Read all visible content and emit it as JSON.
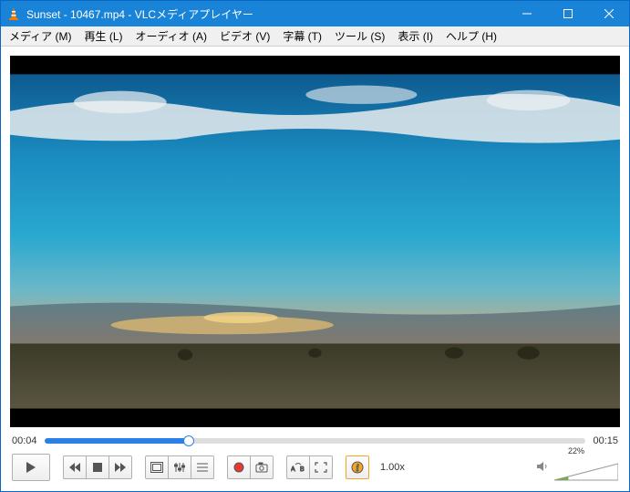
{
  "titlebar": {
    "title": "Sunset - 10467.mp4 - VLCメディアプレイヤー"
  },
  "menu": {
    "media": "メディア (M)",
    "playback": "再生 (L)",
    "audio": "オーディオ (A)",
    "video": "ビデオ (V)",
    "subtitle": "字幕 (T)",
    "tools": "ツール (S)",
    "view": "表示 (I)",
    "help": "ヘルプ (H)"
  },
  "playback": {
    "current_time": "00:04",
    "total_time": "00:15",
    "progress_percent": 26.7,
    "speed": "1.00x"
  },
  "volume": {
    "level_text": "22%",
    "level_percent": 22
  },
  "icons": {
    "play": "play",
    "prev": "prev",
    "stop": "stop",
    "next": "next",
    "fullscreen": "fullscreen",
    "eq": "eq",
    "playlist": "playlist",
    "record": "record",
    "snapshot": "snapshot",
    "loop_ab": "loop_ab",
    "fullscreen2": "fullscreen2",
    "info": "info",
    "speaker": "speaker"
  }
}
